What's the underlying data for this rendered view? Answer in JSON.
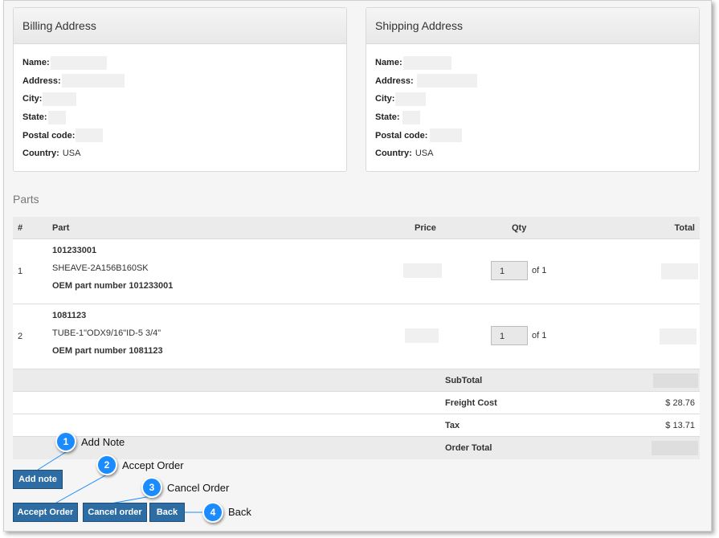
{
  "billing": {
    "title": "Billing Address",
    "fields": [
      {
        "label": "Name:"
      },
      {
        "label": "Address:"
      },
      {
        "label": "City:"
      },
      {
        "label": "State:"
      },
      {
        "label": "Postal code:"
      },
      {
        "label": "Country:",
        "value": "USA"
      }
    ]
  },
  "shipping": {
    "title": "Shipping Address",
    "fields": [
      {
        "label": "Name:"
      },
      {
        "label": "Address:"
      },
      {
        "label": "City:"
      },
      {
        "label": "State:"
      },
      {
        "label": "Postal code:"
      },
      {
        "label": "Country:",
        "value": "USA"
      }
    ]
  },
  "parts": {
    "title": "Parts",
    "headers": {
      "num": "#",
      "part": "Part",
      "price": "Price",
      "qty": "Qty",
      "total": "Total"
    },
    "rows": [
      {
        "num": "1",
        "code": "101233001",
        "description": "SHEAVE-2A156B160SK",
        "oem": "OEM part number 101233001",
        "qty": "1",
        "of": "of 1"
      },
      {
        "num": "2",
        "code": "1081123",
        "description": "TUBE-1\"ODX9/16\"ID-5 3/4\"",
        "oem": "OEM part number 1081123",
        "qty": "1",
        "of": "of 1"
      }
    ],
    "summary": {
      "subtotal_label": "SubTotal",
      "freight_label": "Freight Cost",
      "freight_value": "$ 28.76",
      "tax_label": "Tax",
      "tax_value": "$ 13.71",
      "order_total_label": "Order Total"
    }
  },
  "buttons": {
    "add_note": "Add note",
    "accept_order": "Accept Order",
    "cancel_order": "Cancel order",
    "back": "Back"
  },
  "callouts": [
    {
      "number": "1",
      "label": "Add Note"
    },
    {
      "number": "2",
      "label": "Accept Order"
    },
    {
      "number": "3",
      "label": "Cancel Order"
    },
    {
      "number": "4",
      "label": "Back"
    }
  ],
  "colors": {
    "button": "#2e6da4",
    "callout": "#1a8cff"
  }
}
